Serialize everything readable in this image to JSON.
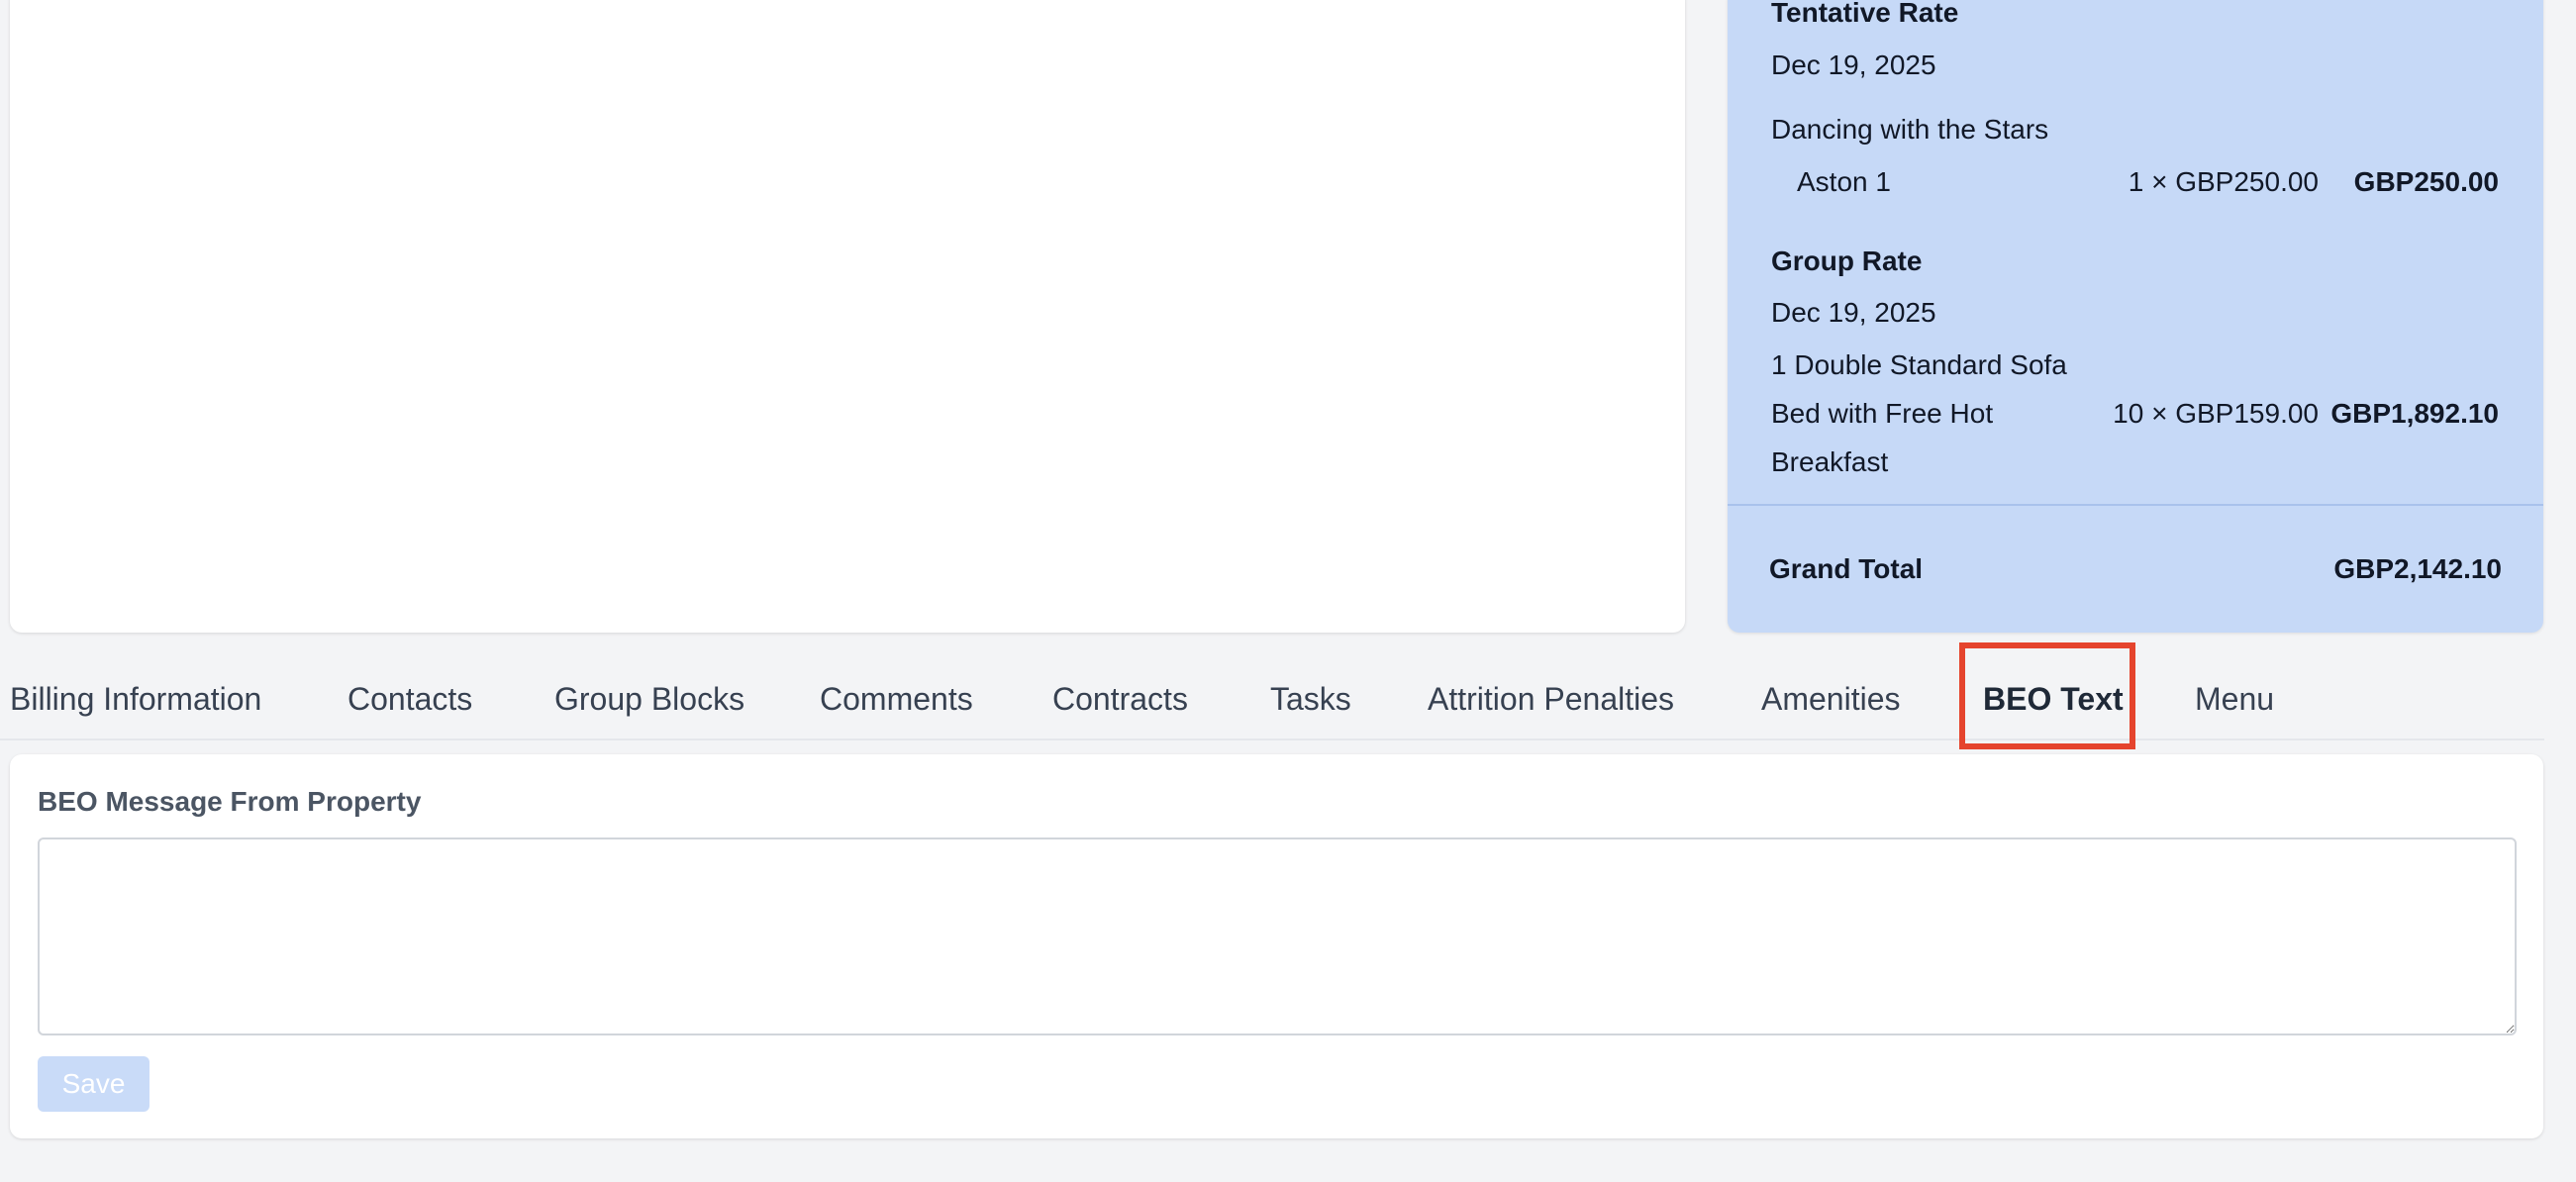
{
  "summary": {
    "tentative_rate": {
      "heading": "Tentative Rate",
      "date": "Dec 19, 2025",
      "event": "Dancing with the Stars",
      "line_item": {
        "room": "Aston 1",
        "qty_price": "1 × GBP250.00",
        "total": "GBP250.00"
      }
    },
    "group_rate": {
      "heading": "Group Rate",
      "date": "Dec 19, 2025",
      "description_lines": [
        "1 Double Standard Sofa",
        "Bed with Free Hot",
        "Breakfast"
      ],
      "qty_price": "10 × GBP159.00",
      "total": "GBP1,892.10"
    },
    "grand_total": {
      "label": "Grand Total",
      "value": "GBP2,142.10"
    }
  },
  "tabs": [
    {
      "label": "Billing Information"
    },
    {
      "label": "Contacts"
    },
    {
      "label": "Group Blocks"
    },
    {
      "label": "Comments"
    },
    {
      "label": "Contracts"
    },
    {
      "label": "Tasks"
    },
    {
      "label": "Attrition Penalties"
    },
    {
      "label": "Amenities"
    },
    {
      "label": "BEO Text",
      "active": true
    },
    {
      "label": "Menu"
    }
  ],
  "beo": {
    "label": "BEO Message From Property",
    "value": "",
    "save_label": "Save"
  },
  "colors": {
    "summary_bg": "#c6d9f7",
    "highlight": "#e5442d",
    "save_disabled": "#c9dbf8"
  }
}
